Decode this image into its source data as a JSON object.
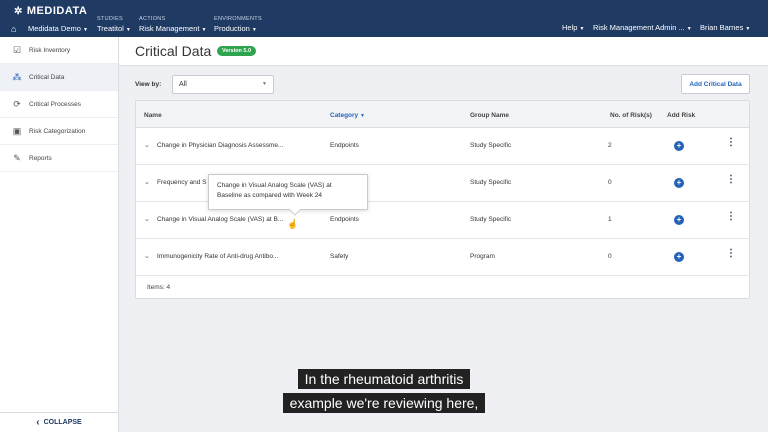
{
  "topbar": {
    "brand": "MEDIDATA",
    "nav": [
      {
        "small": "",
        "main": "Medidata Demo"
      },
      {
        "small": "STUDIES",
        "main": "Treatitol"
      },
      {
        "small": "ACTIONS",
        "main": "Risk Management"
      },
      {
        "small": "ENVIRONMENTS",
        "main": "Production"
      }
    ],
    "help": "Help",
    "role": "Risk Management Admin ...",
    "user": "Brian Barnes"
  },
  "sidebar": {
    "items": [
      {
        "label": "Risk Inventory",
        "icon": "checklist-icon"
      },
      {
        "label": "Critical Data",
        "icon": "nodes-icon"
      },
      {
        "label": "Critical Processes",
        "icon": "cycle-icon"
      },
      {
        "label": "Risk Categorization",
        "icon": "camera-icon"
      },
      {
        "label": "Reports",
        "icon": "edit-icon"
      }
    ],
    "collapse": "COLLAPSE"
  },
  "header": {
    "title": "Critical Data",
    "version": "Version 5.0"
  },
  "filter": {
    "label": "View by:",
    "value": "All",
    "add_label": "Add Critical Data"
  },
  "table": {
    "columns": {
      "name": "Name",
      "category": "Category",
      "group": "Group Name",
      "risks": "No. of Risk(s)",
      "add": "Add Risk"
    },
    "rows": [
      {
        "name": "Change in Physician Diagnosis Assessme...",
        "category": "Endpoints",
        "group": "Study Specific",
        "risks": "2"
      },
      {
        "name": "Frequency and S",
        "category": "",
        "group": "Study Specific",
        "risks": "0"
      },
      {
        "name": "Change in Visual Analog Scale (VAS) at B...",
        "category": "Endpoints",
        "group": "Study Specific",
        "risks": "1"
      },
      {
        "name": "Immunogenicity Rate of Anti-drug Antibo...",
        "category": "Safety",
        "group": "Program",
        "risks": "0"
      }
    ],
    "footer": "Items: 4"
  },
  "tooltip": {
    "line1": "Change in Visual Analog Scale (VAS) at",
    "line2": "Baseline as compared with Week 24"
  },
  "captions": {
    "line1": "In the rheumatoid arthritis",
    "line2": "example we're reviewing here,"
  }
}
